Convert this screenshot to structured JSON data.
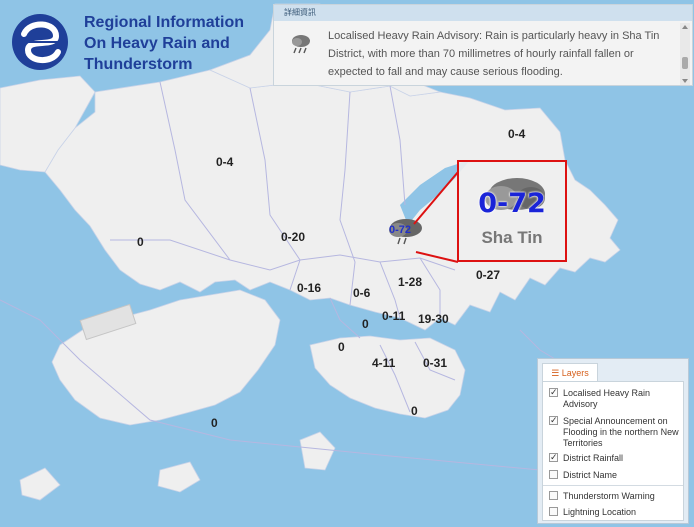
{
  "header": {
    "title_lines": [
      "Regional Information",
      "On Heavy Rain and",
      "Thunderstorm"
    ],
    "logo": "hong-kong-observatory-logo"
  },
  "details": {
    "heading": "詳細資訊",
    "text": "Localised Heavy Rain Advisory: Rain is particularly heavy in Sha Tin District, with more than 70 millimetres of hourly rainfall fallen or expected to fall and may cause serious flooding.",
    "icon": "heavy-rain-icon"
  },
  "map_labels": [
    "0-4",
    "0-4",
    "0",
    "0-20",
    "0-72",
    "0-27",
    "0-16",
    "0-6",
    "1-28",
    "0",
    "0-11",
    "19-30",
    "0",
    "4-11",
    "0-31",
    "0",
    "0"
  ],
  "callout": {
    "value": "0-72",
    "district": "Sha Tin"
  },
  "layers": {
    "title": "Layers",
    "items": [
      {
        "label": "Localised Heavy Rain Advisory",
        "checked": true
      },
      {
        "label": "Special Announcement on Flooding in the northern New Territories",
        "checked": true
      },
      {
        "label": "District Rainfall",
        "checked": true
      },
      {
        "label": "District Name",
        "checked": false
      },
      {
        "label": "Thunderstorm Warning",
        "checked": false
      },
      {
        "label": "Lightning Location",
        "checked": false
      }
    ]
  },
  "colors": {
    "sea": "#8fc4e6",
    "land": "#efefef",
    "callout_border": "#dd1111",
    "highlight_value": "#1a24d8"
  }
}
